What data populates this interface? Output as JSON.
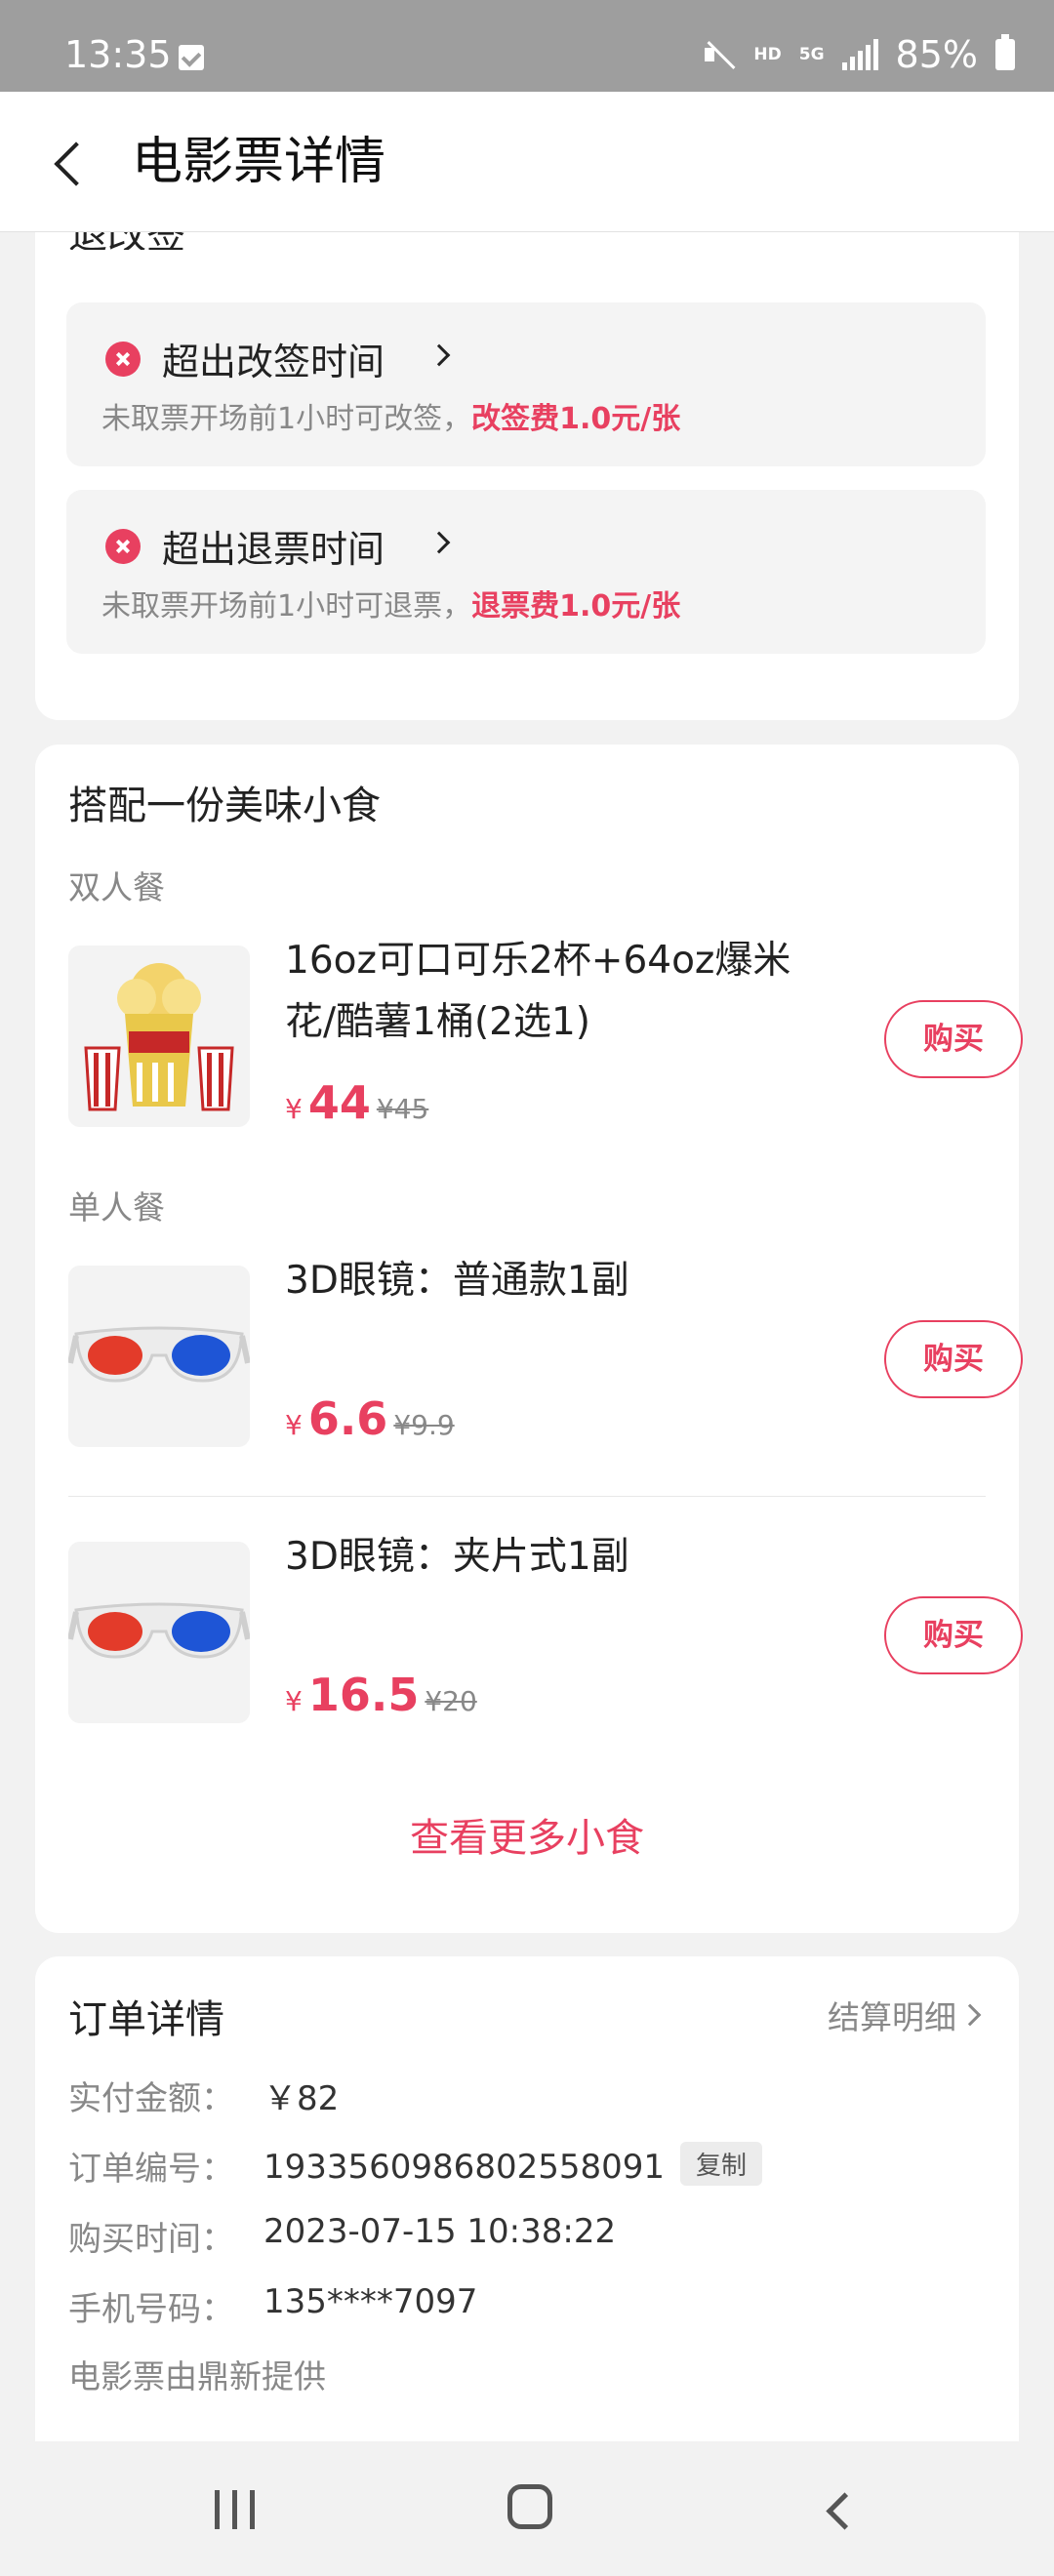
{
  "status_bar": {
    "time": "13:35",
    "network": "HD",
    "network2": "5G",
    "battery": "85%"
  },
  "header": {
    "title": "电影票详情"
  },
  "refund_section": {
    "title": "退改签",
    "rules": [
      {
        "title": "超出改签时间",
        "desc": "未取票开场前1小时可改签，",
        "fee": "改签费1.0元/张"
      },
      {
        "title": "超出退票时间",
        "desc": "未取票开场前1小时可退票，",
        "fee": "退票费1.0元/张"
      }
    ]
  },
  "snacks": {
    "title": "搭配一份美味小食",
    "group_double": "双人餐",
    "group_single": "单人餐",
    "items": [
      {
        "name": "16oz可口可乐2杯+64oz爆米花/酷薯1桶(2选1)",
        "currency": "¥",
        "price": "44",
        "old_price": "¥45",
        "buy": "购买",
        "image_icon": "popcorn-combo"
      },
      {
        "name": "3D眼镜：普通款1副",
        "currency": "¥",
        "price": "6.6",
        "old_price": "¥9.9",
        "buy": "购买",
        "image_icon": "3d-glasses"
      },
      {
        "name": "3D眼镜：夹片式1副",
        "currency": "¥",
        "price": "16.5",
        "old_price": "¥20",
        "buy": "购买",
        "image_icon": "3d-glasses"
      }
    ],
    "more": "查看更多小食"
  },
  "order": {
    "title": "订单详情",
    "link": "结算明细",
    "rows": [
      {
        "label": "实付金额：",
        "value": "￥82"
      },
      {
        "label": "订单编号：",
        "value": "193356098680255​8091"
      },
      {
        "label": "购买时间：",
        "value": "2023-07-15 10:38:22"
      },
      {
        "label": "手机号码：",
        "value": "135****7097"
      }
    ],
    "copy": "复制",
    "provider": "电影票由鼎新提供"
  },
  "colors": {
    "accent": "#e84060",
    "background": "#f2f2f2"
  }
}
